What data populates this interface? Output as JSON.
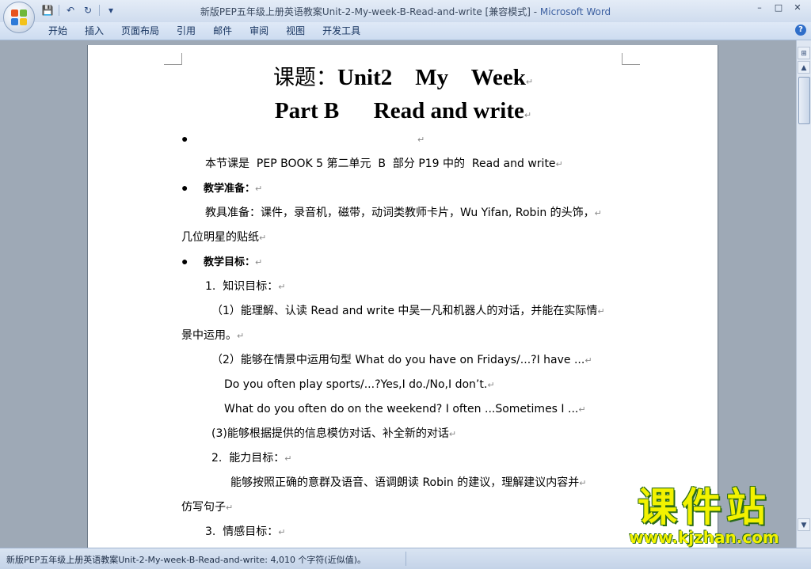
{
  "window": {
    "title": "新版PEP五年级上册英语教案Unit-2-My-week-B-Read-and-write [兼容模式]",
    "title_sep": " - ",
    "app_name": "Microsoft Word",
    "controls": [
      "–",
      "□",
      "✕"
    ]
  },
  "qat": {
    "save": "💾",
    "undo": "↶",
    "redo": "↻",
    "more": "▾"
  },
  "ribbon": {
    "tabs": [
      "开始",
      "插入",
      "页面布局",
      "引用",
      "邮件",
      "审阅",
      "视图",
      "开发工具"
    ],
    "help": "?"
  },
  "document": {
    "title_prefix": "课题：",
    "title_line1": "Unit2    My    Week",
    "title_line2": "Part B      Read and write",
    "para_mark": "↵",
    "lines": [
      {
        "type": "bullet",
        "text": ""
      },
      {
        "type": "indent",
        "text": "本节课是  PEP BOOK 5 第二单元  B  部分 P19 中的  Read and write"
      },
      {
        "type": "bullet-bold",
        "text": "教学准备："
      },
      {
        "type": "indent",
        "text": "教具准备：课件，录音机，磁带，动词类教师卡片，Wu Yifan, Robin 的头饰，"
      },
      {
        "type": "plain",
        "text": "几位明星的贴纸"
      },
      {
        "type": "bullet-bold",
        "text": "教学目标："
      },
      {
        "type": "indent",
        "text": "1.  知识目标："
      },
      {
        "type": "indent2",
        "text": "（1）能理解、认读 Read and write 中吴一凡和机器人的对话，并能在实际情"
      },
      {
        "type": "plain",
        "text": "景中运用。"
      },
      {
        "type": "indent2",
        "text": "（2）能够在情景中运用句型 What do you have on Fridays/...?I have ..."
      },
      {
        "type": "indent3",
        "text": "Do you often play sports/...?Yes,I do./No,I don’t."
      },
      {
        "type": "indent3",
        "text": "What do you often do on the weekend? I often ...Sometimes I ..."
      },
      {
        "type": "indent2",
        "text": "(3)能够根据提供的信息模仿对话、补全新的对话"
      },
      {
        "type": "indent2",
        "text": "2.  能力目标："
      },
      {
        "type": "indent4",
        "text": "能够按照正确的意群及语音、语调朗读 Robin 的建议，理解建议内容并"
      },
      {
        "type": "plain",
        "text": "仿写句子"
      },
      {
        "type": "indent",
        "text": "3.  情感目标："
      }
    ]
  },
  "status": {
    "text": "新版PEP五年级上册英语教案Unit-2-My-week-B-Read-and-write: 4,010 个字符(近似值)。"
  },
  "watermark": {
    "big": "课件站",
    "small": "www.kjzhan.com"
  },
  "scrollbar": {
    "up": "▲",
    "down": "▼"
  },
  "colors": {
    "app_title": "#3b5fa0",
    "watermark": "#f2f200"
  }
}
